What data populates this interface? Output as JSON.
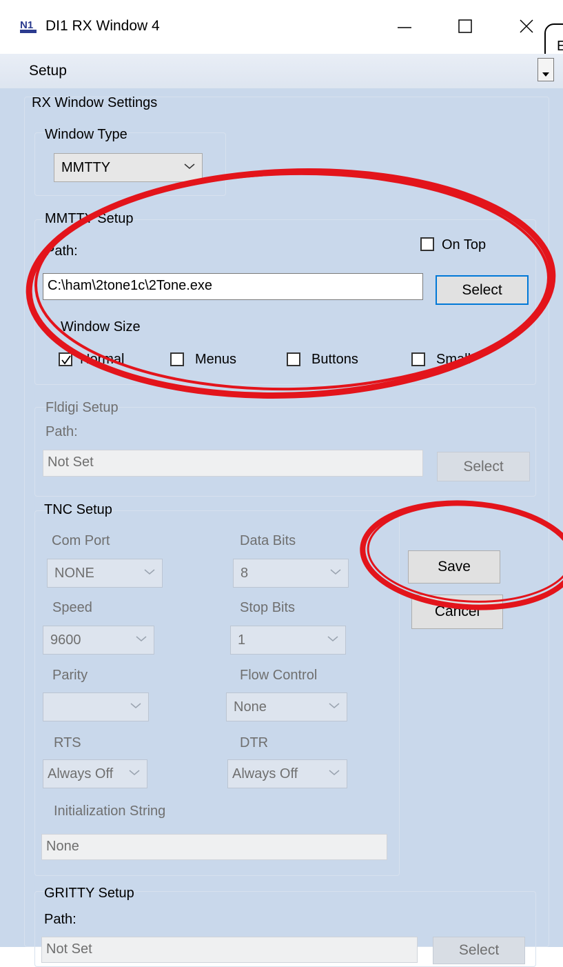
{
  "window": {
    "title": "DI1 RX Window 4",
    "logo_label": "N1",
    "side_tab_text": "E",
    "accent_color": "#0078d7",
    "annotation_color": "#e3141b"
  },
  "menu": {
    "setup": "Setup"
  },
  "settings": {
    "group_title": "RX Window Settings"
  },
  "window_type": {
    "label": "Window Type",
    "value": "MMTTY"
  },
  "mmtty": {
    "title": "MMTTY Setup",
    "path_label": "Path:",
    "path_value": "C:\\ham\\2tone1c\\2Tone.exe",
    "on_top_label": "On Top",
    "on_top_checked": false,
    "select_label": "Select",
    "window_size_label": "Window Size",
    "sizes": [
      {
        "label": "Normal",
        "checked": true
      },
      {
        "label": "Menus",
        "checked": false
      },
      {
        "label": "Buttons",
        "checked": false
      },
      {
        "label": "Small",
        "checked": false
      }
    ]
  },
  "fldigi": {
    "title": "Fldigi Setup",
    "path_label": "Path:",
    "path_value": "Not Set",
    "select_label": "Select"
  },
  "tnc": {
    "title": "TNC Setup",
    "com_port_label": "Com Port",
    "com_port_value": "NONE",
    "data_bits_label": "Data Bits",
    "data_bits_value": "8",
    "speed_label": "Speed",
    "speed_value": "9600",
    "stop_bits_label": "Stop Bits",
    "stop_bits_value": "1",
    "parity_label": "Parity",
    "parity_value": "",
    "flow_control_label": "Flow Control",
    "flow_control_value": "None",
    "rts_label": "RTS",
    "rts_value": "Always Off",
    "dtr_label": "DTR",
    "dtr_value": "Always Off",
    "init_label": "Initialization String",
    "init_value": "None"
  },
  "actions": {
    "save": "Save",
    "cancel": "Cancel"
  },
  "gritty": {
    "title": "GRITTY Setup",
    "path_label": "Path:",
    "path_value": "Not Set",
    "select_label": "Select"
  }
}
